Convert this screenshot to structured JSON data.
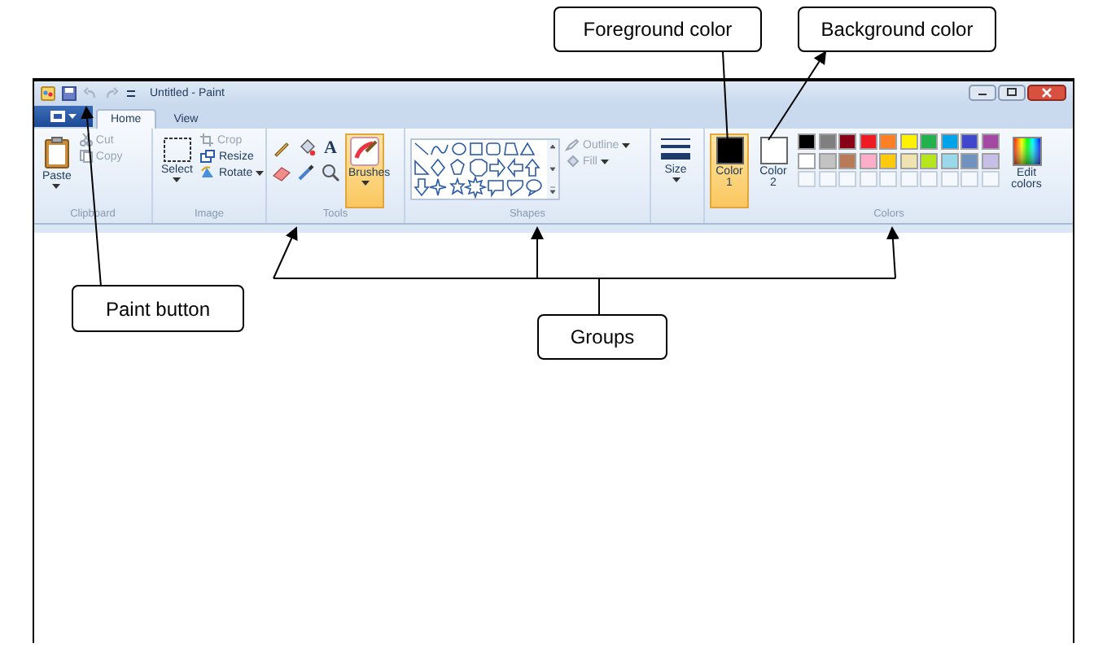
{
  "callouts": [
    {
      "text": "Foreground color"
    },
    {
      "text": "Background color"
    },
    {
      "text": "Paint button"
    },
    {
      "text": "Groups"
    }
  ],
  "window": {
    "title": "Untitled - Paint"
  },
  "tabs": [
    {
      "label": "Home",
      "selected": true
    },
    {
      "label": "View",
      "selected": false
    }
  ],
  "ribbon": {
    "clipboard": {
      "label": "Clipboard",
      "paste": {
        "label": "Paste"
      },
      "actions": [
        {
          "label": "Cut",
          "disabled": true
        },
        {
          "label": "Copy",
          "disabled": true
        }
      ]
    },
    "image": {
      "label": "Image",
      "select": {
        "label": "Select"
      },
      "actions": [
        {
          "label": "Crop",
          "disabled": true
        },
        {
          "label": "Resize",
          "disabled": false
        },
        {
          "label": "Rotate",
          "disabled": false
        }
      ]
    },
    "tools": {
      "label": "Tools",
      "text_tool": "A",
      "brushes": {
        "label": "Brushes",
        "selected": true
      }
    },
    "shapes": {
      "label": "Shapes",
      "options": [
        {
          "label": "Outline",
          "disabled": true
        },
        {
          "label": "Fill",
          "disabled": true
        }
      ]
    },
    "size": {
      "label": "Size"
    },
    "colors": {
      "label": "Colors",
      "slots": [
        {
          "label": "Color 1",
          "selected": true,
          "color": "#000000"
        },
        {
          "label": "Color 2",
          "selected": false,
          "color": "#ffffff"
        }
      ],
      "palette": [
        {
          "kind": "swatch",
          "color": "#000000"
        },
        {
          "kind": "swatch",
          "color": "#7f7f7f"
        },
        {
          "kind": "swatch",
          "color": "#880015"
        },
        {
          "kind": "swatch",
          "color": "#ed1c24"
        },
        {
          "kind": "swatch",
          "color": "#ff7f27"
        },
        {
          "kind": "swatch",
          "color": "#fff200"
        },
        {
          "kind": "swatch",
          "color": "#22b14c"
        },
        {
          "kind": "swatch",
          "color": "#00a2e8"
        },
        {
          "kind": "swatch",
          "color": "#3f48cc"
        },
        {
          "kind": "swatch",
          "color": "#a349a4"
        },
        {
          "kind": "swatch",
          "color": "#ffffff"
        },
        {
          "kind": "swatch",
          "color": "#c3c3c3"
        },
        {
          "kind": "swatch",
          "color": "#b97a57"
        },
        {
          "kind": "swatch",
          "color": "#ffaec9"
        },
        {
          "kind": "swatch",
          "color": "#ffc90e"
        },
        {
          "kind": "swatch",
          "color": "#efe4b0"
        },
        {
          "kind": "swatch",
          "color": "#b5e61d"
        },
        {
          "kind": "swatch",
          "color": "#99d9ea"
        },
        {
          "kind": "swatch",
          "color": "#7092be"
        },
        {
          "kind": "swatch",
          "color": "#c8bfe7"
        },
        {
          "kind": "empty"
        },
        {
          "kind": "empty"
        },
        {
          "kind": "empty"
        },
        {
          "kind": "empty"
        },
        {
          "kind": "empty"
        },
        {
          "kind": "empty"
        },
        {
          "kind": "empty"
        },
        {
          "kind": "empty"
        },
        {
          "kind": "empty"
        },
        {
          "kind": "empty"
        }
      ],
      "edit": {
        "label": "Edit colors"
      }
    }
  }
}
